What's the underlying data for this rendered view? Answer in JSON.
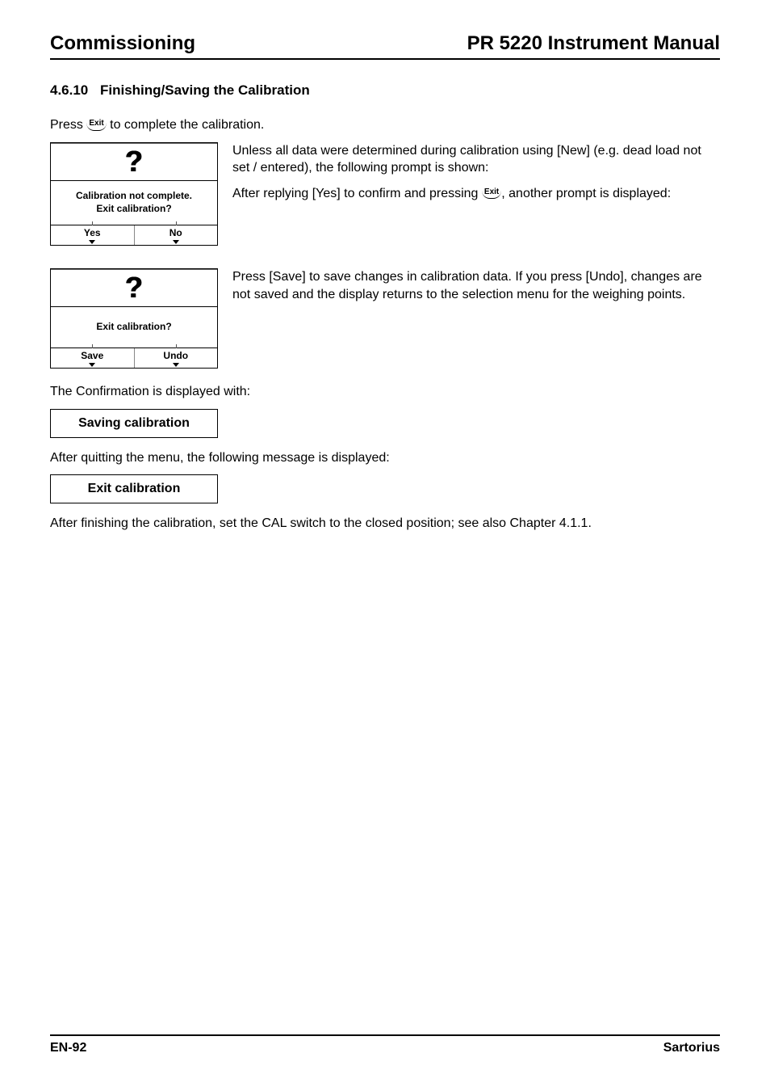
{
  "header": {
    "left": "Commissioning",
    "right": "PR 5220 Instrument Manual"
  },
  "section": {
    "number": "4.6.10",
    "title": "Finishing/Saving the Calibration"
  },
  "press_line_before": "Press ",
  "press_line_after": " to complete the calibration.",
  "exit_key_label": "Exit",
  "screen1": {
    "msg_line1": "Calibration not complete.",
    "msg_line2": "Exit calibration?",
    "btn_left": "Yes",
    "btn_right": "No"
  },
  "row1_para1": "Unless all data were determined during calibration using [New] (e.g. dead load not set / entered), the following prompt is shown:",
  "row1_para2_before": "After replying [Yes] to confirm and pressing ",
  "row1_para2_after": ", another prompt is displayed:",
  "screen2": {
    "msg": "Exit calibration?",
    "btn_left": "Save",
    "btn_right": "Undo"
  },
  "row2_para": "Press [Save] to save changes in calibration data. If you press [Undo], changes are not saved and the display returns to the selection menu for the weighing points.",
  "confirm_intro": "The Confirmation is displayed with:",
  "box_saving": "Saving calibration",
  "after_quit": "After quitting the menu, the following message is displayed:",
  "box_exit": "Exit calibration",
  "closing": "After finishing the calibration, set the CAL switch to the closed position; see also Chapter 4.1.1.",
  "footer": {
    "left": "EN-92",
    "right": "Sartorius"
  }
}
